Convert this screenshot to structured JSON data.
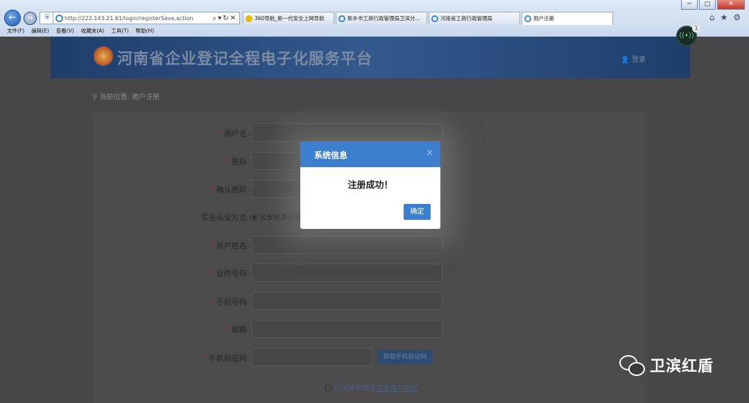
{
  "browser": {
    "address": "http://222.143.21.61/login/registerSave.action",
    "tabs": [
      {
        "label": "360导航_新一代安全上网导航",
        "icon": "360-icon"
      },
      {
        "label": "新乡市工商行政管理局卫滨分...",
        "icon": "ie-icon"
      },
      {
        "label": "河南省工商行政管理局",
        "icon": "ie-icon"
      },
      {
        "label": "用户注册",
        "icon": "ie-icon",
        "active": true
      }
    ],
    "menu": [
      "文件(F)",
      "编辑(E)",
      "查看(V)",
      "收藏夹(A)",
      "工具(T)",
      "帮助(H)"
    ],
    "window_buttons": {
      "minimize": "─",
      "maximize": "□",
      "close": "✕"
    }
  },
  "site": {
    "title": "河南省企业登记全程电子化服务平台",
    "login": "登录",
    "breadcrumb": "当前位置: 用户注册"
  },
  "form": {
    "username": "用户名 :",
    "password": "密码 :",
    "confirm_password": "确认密码 :",
    "auth_method": "实名认证方式 :",
    "auth_option": "公安机关认证",
    "real_name": "用户姓名 :",
    "id_number": "证件号码 :",
    "phone": "手机号码 :",
    "email": "邮箱 :",
    "sms_code": "手机验证码 :",
    "sms_button": "获取手机验证码",
    "agree_text": "已阅读并同意",
    "agree_link": "注册用户协议"
  },
  "notification": {
    "badge": "1"
  },
  "modal": {
    "title": "系统信息",
    "close": "×",
    "message": "注册成功！",
    "ok": "确定"
  },
  "watermark": {
    "text": "卫滨红盾"
  }
}
